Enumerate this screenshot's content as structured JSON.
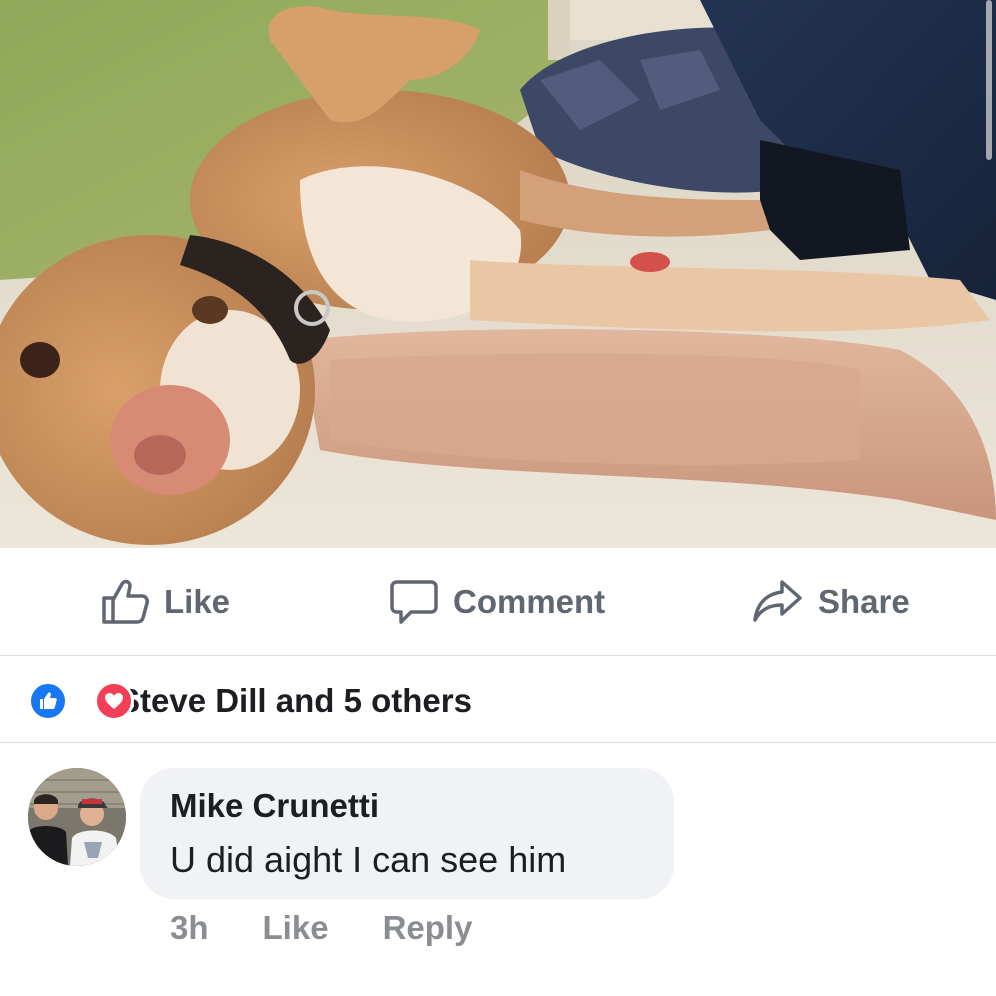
{
  "post": {
    "photo_icon": "dog-photo",
    "actions": {
      "like_label": "Like",
      "comment_label": "Comment",
      "share_label": "Share"
    },
    "reactions": {
      "icons": [
        "like-reaction-icon",
        "love-reaction-icon"
      ],
      "summary": "Steve Dill and 5 others"
    }
  },
  "comment": {
    "author": "Mike Crunetti",
    "text": "U did aight I can see him",
    "time": "3h",
    "like_label": "Like",
    "reply_label": "Reply"
  },
  "colors": {
    "action_text": "#606770",
    "like_blue": "#1877f2",
    "love_red": "#f33e58",
    "bubble": "#f0f2f5",
    "meta_text": "#8a8d91",
    "divider": "#dadde1"
  }
}
